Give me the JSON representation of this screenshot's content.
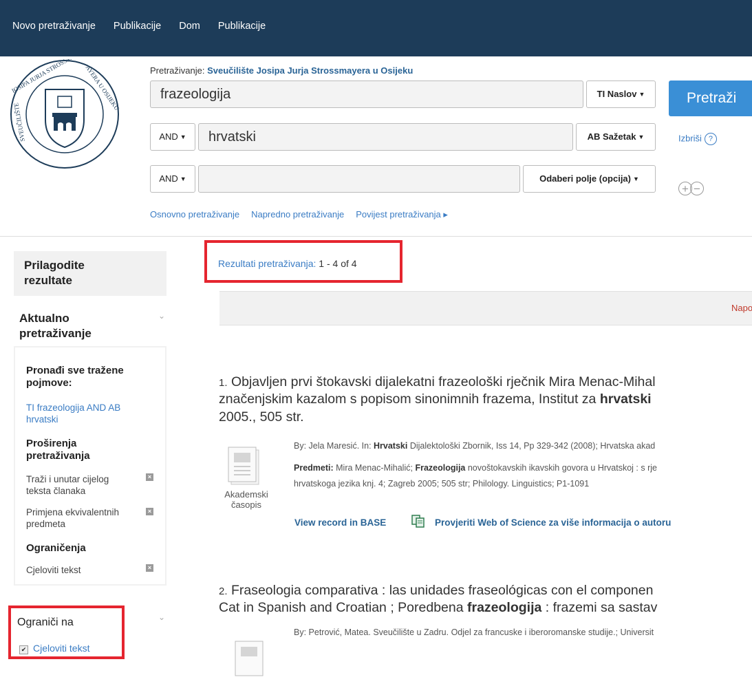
{
  "top_nav": {
    "items": [
      "Novo pretraživanje",
      "Publikacije",
      "Dom",
      "Publikacije"
    ]
  },
  "search": {
    "label": "Pretraživanje:",
    "source": "Sveučilište Josipa Jurja Strossmayera u Osijeku",
    "rows": [
      {
        "operator": "",
        "value": "frazeologija",
        "field": "TI Naslov"
      },
      {
        "operator": "AND",
        "value": "hrvatski",
        "field": "AB Sažetak"
      },
      {
        "operator": "AND",
        "value": "",
        "field": "Odaberi polje (opcija)"
      }
    ],
    "search_button": "Pretraži",
    "clear_link": "Izbriši",
    "links": [
      "Osnovno pretraživanje",
      "Napredno pretraživanje",
      "Povijest pretraživanja ▸"
    ]
  },
  "sidebar": {
    "title": "Prilagodite rezultate",
    "current_search": {
      "heading": "Aktualno pretraživanje",
      "find_all_heading": "Pronađi sve tražene pojmove:",
      "query": "TI frazeologija AND AB hrvatski",
      "expanders_heading": "Proširenja pretraživanja",
      "expanders": [
        "Traži i unutar cijelog teksta članaka",
        "Primjena ekvivalentnih predmeta"
      ],
      "limiters_heading": "Ograničenja",
      "limiters": [
        "Cjeloviti tekst"
      ]
    },
    "limit_to": {
      "heading": "Ograniči na",
      "options": [
        {
          "label": "Cjeloviti tekst",
          "checked": true
        }
      ]
    }
  },
  "results": {
    "label": "Rezultati pretraživanja:",
    "count": "1 - 4 of 4",
    "sort_label": "Napo",
    "items": [
      {
        "number": "1.",
        "title_lines": [
          [
            "Objavljen prvi štokavski dijalekatni frazeološki rječnik Mira Menac-Mihal"
          ],
          [
            "značenjskim kazalom s popisom sinonimnih frazema, Institut za ",
            "hrvatski"
          ],
          [
            "2005., 505 str."
          ]
        ],
        "byline": [
          "By: Jela Maresić. In: ",
          "Hrvatski",
          " Dijalektološki Zbornik, Iss 14, Pp 329-342 (2008); Hrvatska akad"
        ],
        "subjects_label": "Predmeti:",
        "subjects_line1": [
          " Mira Menac-Mihalić; ",
          "Frazeologija",
          " novoštokavskih ikavskih govora u Hrvatskoj : s rje"
        ],
        "subjects_line2": "hrvatskoga jezika knj. 4; Zagreb 2005; 505 str; Philology. Linguistics; P1-1091",
        "pub_type": "Akademski časopis",
        "links": [
          "View record in BASE",
          "Provjeriti Web of Science za više informacija o autoru"
        ]
      },
      {
        "number": "2.",
        "title_lines": [
          [
            "Fraseologia comparativa : las unidades fraseológicas con el componen"
          ],
          [
            "Cat in Spanish and Croatian ; Poredbena ",
            "frazeologija",
            " : frazemi sa sastav"
          ]
        ],
        "byline": [
          "By: Petrović, Matea. Sveučilište u Zadru. Odjel za francuske i iberoromanske studije.; Universit"
        ]
      }
    ]
  }
}
